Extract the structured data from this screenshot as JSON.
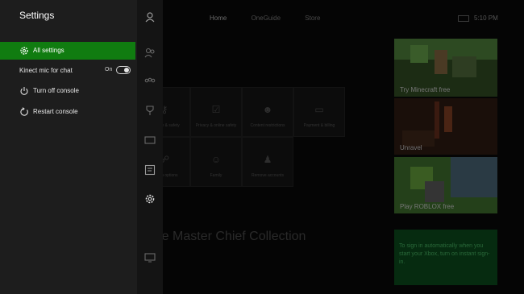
{
  "settings_panel": {
    "title": "Settings",
    "items": [
      {
        "label": "All settings",
        "icon": "gear-icon"
      },
      {
        "label": "Kinect mic for chat",
        "toggle_state": "On",
        "icon": "toggle-icon"
      },
      {
        "label": "Turn off console",
        "icon": "power-icon"
      },
      {
        "label": "Restart console",
        "icon": "restart-icon"
      }
    ]
  },
  "rail": {
    "icons": [
      "profile-icon",
      "friends-icon",
      "party-icon",
      "achievements-icon",
      "messages-icon",
      "notifications-icon",
      "settings-gear-icon",
      "snap-icon"
    ]
  },
  "background": {
    "nav_tabs": [
      "Home",
      "OneGuide",
      "Store"
    ],
    "time": "5:10 PM",
    "tiles_row1": [
      "Security & safety",
      "Privacy & online safety",
      "Content restrictions",
      "Payment & billing"
    ],
    "tiles_row2": [
      "Sign-in options",
      "Family",
      "Remove accounts"
    ],
    "cards": [
      {
        "label": "Try Minecraft free",
        "color": "#4a7a34"
      },
      {
        "label": "Unravel",
        "color": "#3a1c10"
      },
      {
        "label": "Play ROBLOX free",
        "color": "#3c7a2a"
      }
    ],
    "collection_title": "The Master Chief Collection",
    "signin_text": "To sign in automatically when you start your Xbox, turn on instant sign-in."
  },
  "colors": {
    "accent": "#107c10",
    "panel_bg": "#1d1d1d",
    "rail_bg": "#141414"
  }
}
